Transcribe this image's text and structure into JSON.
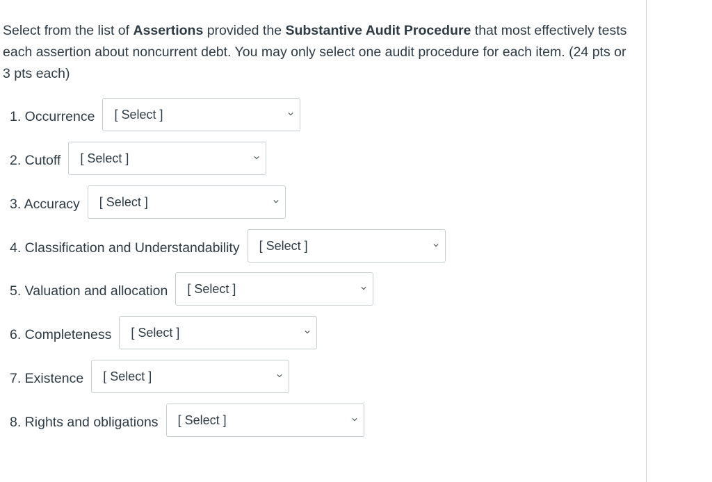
{
  "instructions": {
    "part1": "Select from the list of ",
    "bold1": "Assertions",
    "part2": " provided the ",
    "bold2": "Substantive Audit Procedure",
    "part3": " that most effectively tests each assertion about noncurrent debt. You may only select one audit procedure for each item. (24 pts or 3 pts each)"
  },
  "items": [
    {
      "label": "1. Occurrence",
      "selected": "[ Select ]"
    },
    {
      "label": "2. Cutoff",
      "selected": "[ Select ]"
    },
    {
      "label": "3. Accuracy",
      "selected": "[ Select ]"
    },
    {
      "label": "4. Classification and Understandability",
      "selected": "[ Select ]"
    },
    {
      "label": "5. Valuation and allocation",
      "selected": "[ Select ]"
    },
    {
      "label": "6. Completeness",
      "selected": "[ Select ]"
    },
    {
      "label": "7. Existence",
      "selected": "[ Select ]"
    },
    {
      "label": "8. Rights and obligations",
      "selected": "[ Select ]"
    }
  ]
}
